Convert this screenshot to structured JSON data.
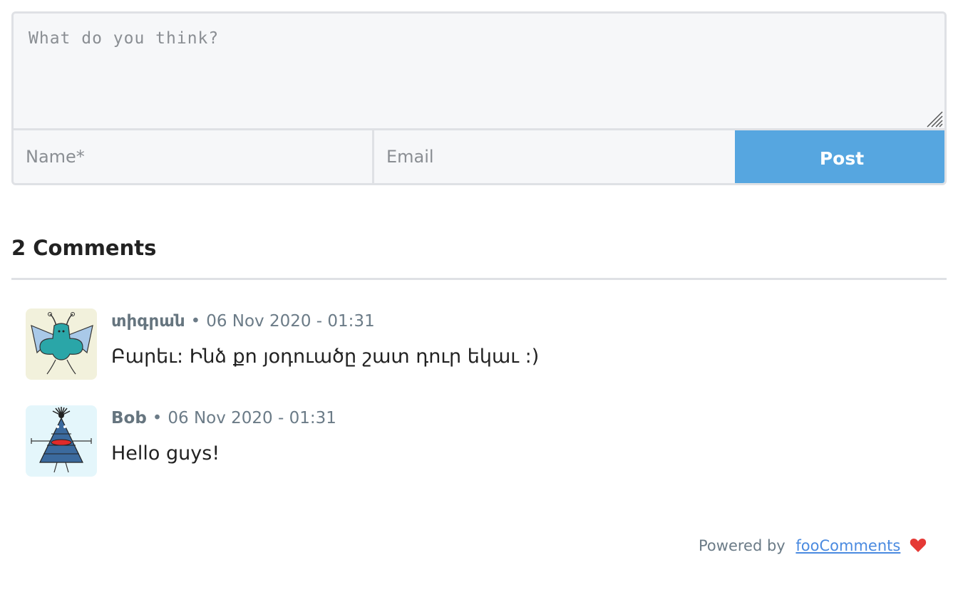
{
  "form": {
    "comment_placeholder": "What do you think?",
    "name_placeholder": "Name*",
    "email_placeholder": "Email",
    "post_label": "Post",
    "accent_color": "#56a6e0"
  },
  "comments_header": {
    "title": "2 Comments"
  },
  "comments": [
    {
      "author": "տիգրան",
      "separator": "•",
      "timestamp": "06 Nov 2020 - 01:31",
      "text": "Բարեւ: Ինձ քո յօդուածը շատ դուր եկաւ :)",
      "avatar_icon": "winged-creature-avatar-icon"
    },
    {
      "author": "Bob",
      "separator": "•",
      "timestamp": "06 Nov 2020 - 01:31",
      "text": "Hello guys!",
      "avatar_icon": "triangle-creature-avatar-icon"
    }
  ],
  "footer": {
    "powered_by": "Powered by",
    "link_text": "fooComments",
    "heart_color": "#e53935",
    "heart_icon": "heart-icon"
  }
}
